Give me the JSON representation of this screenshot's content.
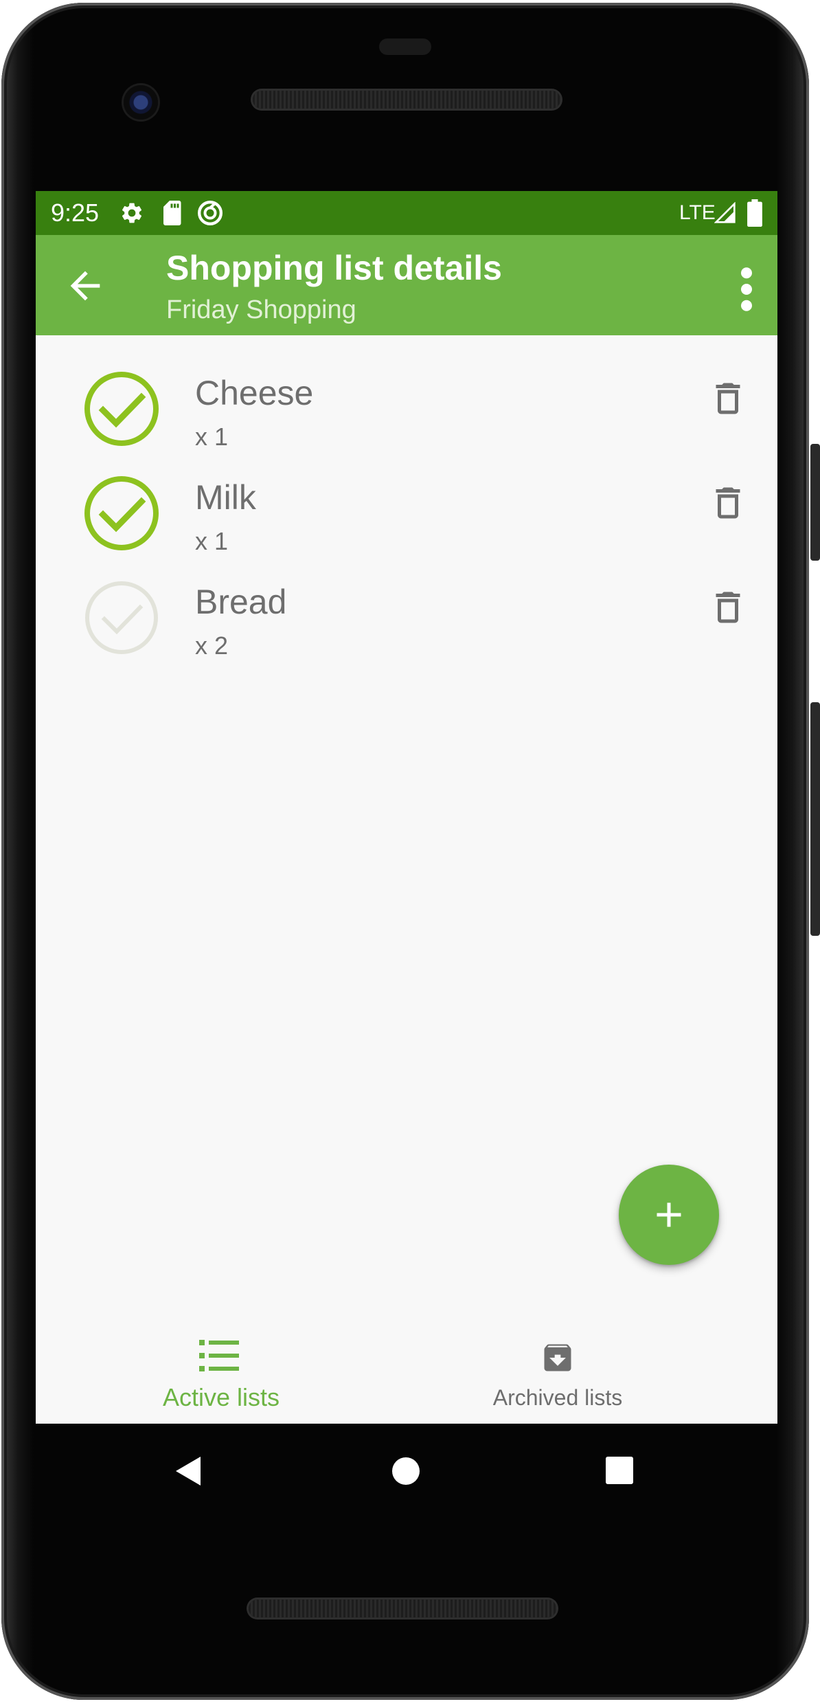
{
  "status_bar": {
    "time": "9:25",
    "network": "LTE",
    "icons": [
      "settings-icon",
      "sd-card-icon",
      "sync-icon",
      "signal-icon",
      "battery-icon"
    ]
  },
  "app_bar": {
    "title": "Shopping list details",
    "subtitle": "Friday Shopping",
    "back_icon": "arrow-back-icon",
    "menu_icon": "more-vert-icon"
  },
  "items": [
    {
      "name": "Cheese",
      "quantity": "x 1",
      "checked": true
    },
    {
      "name": "Milk",
      "quantity": "x 1",
      "checked": true
    },
    {
      "name": "Bread",
      "quantity": "x 2",
      "checked": false
    }
  ],
  "fab": {
    "icon": "add-icon"
  },
  "bottom_nav": [
    {
      "label": "Active lists",
      "icon": "list-icon",
      "active": true
    },
    {
      "label": "Archived lists",
      "icon": "archive-icon",
      "active": false
    }
  ],
  "system_nav": [
    "back-icon",
    "home-icon",
    "recents-icon"
  ],
  "colors": {
    "status_bar": "#38800f",
    "app_bar": "#6db444",
    "accent": "#6db444",
    "checked": "#8dc21f",
    "unchecked": "#e2e3da",
    "text": "#6e6e6e"
  }
}
